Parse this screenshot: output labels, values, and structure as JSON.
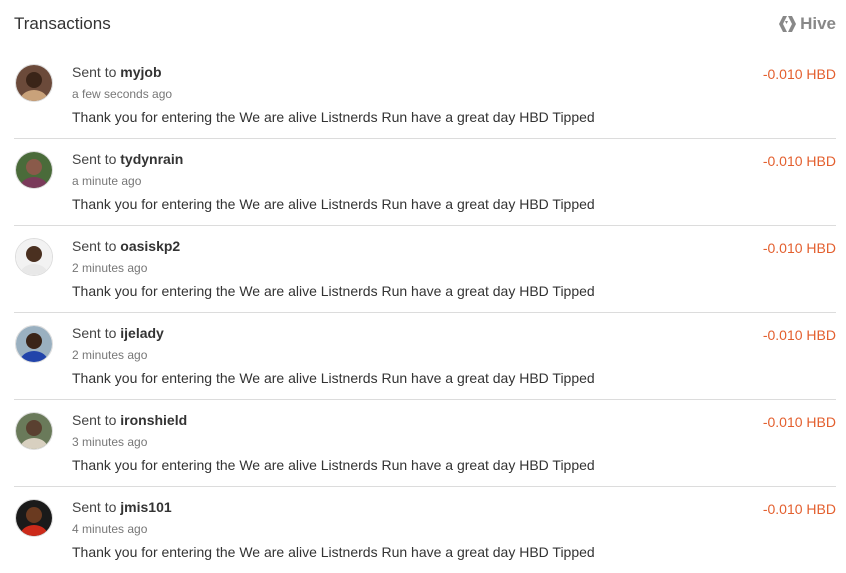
{
  "header": {
    "title": "Transactions",
    "brand": "Hive"
  },
  "colors": {
    "amount": "#e35f2e",
    "divider": "#dcdcdc"
  },
  "transactions": [
    {
      "prefix": "Sent to",
      "user": "myjob",
      "time": "a few seconds ago",
      "memo": "Thank you for entering the We are alive Listnerds Run have a great day HBD Tipped",
      "amount": "-0.010 HBD",
      "avatar": {
        "bg": "#6b4a3a",
        "face": "#3a2418",
        "shirt": "#c9a27a"
      }
    },
    {
      "prefix": "Sent to",
      "user": "tydynrain",
      "time": "a minute ago",
      "memo": "Thank you for entering the We are alive Listnerds Run have a great day HBD Tipped",
      "amount": "-0.010 HBD",
      "avatar": {
        "bg": "#4a6b3a",
        "face": "#8a5a4a",
        "shirt": "#7a3a5a"
      }
    },
    {
      "prefix": "Sent to",
      "user": "oasiskp2",
      "time": "2 minutes ago",
      "memo": "Thank you for entering the We are alive Listnerds Run have a great day HBD Tipped",
      "amount": "-0.010 HBD",
      "avatar": {
        "bg": "#f2f2f2",
        "face": "#4a3020",
        "shirt": "#e8e8e8"
      }
    },
    {
      "prefix": "Sent to",
      "user": "ijelady",
      "time": "2 minutes ago",
      "memo": "Thank you for entering the We are alive Listnerds Run have a great day HBD Tipped",
      "amount": "-0.010 HBD",
      "avatar": {
        "bg": "#9ab0c0",
        "face": "#3a2418",
        "shirt": "#2244aa"
      }
    },
    {
      "prefix": "Sent to",
      "user": "ironshield",
      "time": "3 minutes ago",
      "memo": "Thank you for entering the We are alive Listnerds Run have a great day HBD Tipped",
      "amount": "-0.010 HBD",
      "avatar": {
        "bg": "#6a7a5a",
        "face": "#5a4030",
        "shirt": "#d8d0c0"
      }
    },
    {
      "prefix": "Sent to",
      "user": "jmis101",
      "time": "4 minutes ago",
      "memo": "Thank you for entering the We are alive Listnerds Run have a great day HBD Tipped",
      "amount": "-0.010 HBD",
      "avatar": {
        "bg": "#1a1a1a",
        "face": "#6a3a20",
        "shirt": "#cc2a1a"
      }
    }
  ]
}
